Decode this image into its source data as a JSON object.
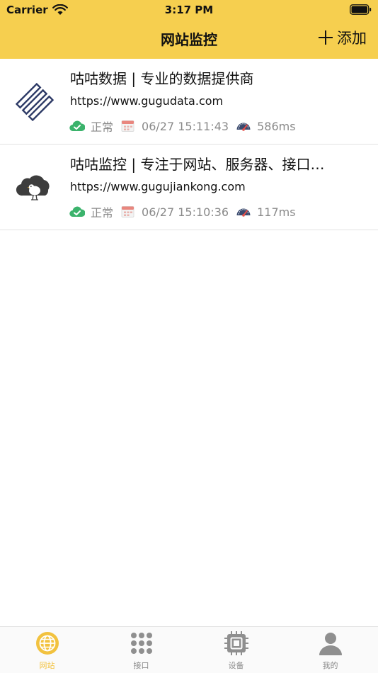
{
  "status_bar": {
    "carrier": "Carrier",
    "time": "3:17 PM"
  },
  "nav": {
    "title": "网站监控",
    "add_label": "添加"
  },
  "sites": [
    {
      "icon": "gugudata-logo-icon",
      "title": "咕咕数据 | 专业的数据提供商",
      "url": "https://www.gugudata.com",
      "status": "正常",
      "time": "06/27 15:11:43",
      "latency": "586ms"
    },
    {
      "icon": "gugujiankong-logo-icon",
      "title": "咕咕监控 | 专注于网站、服务器、接口…",
      "url": "https://www.gugujiankong.com",
      "status": "正常",
      "time": "06/27 15:10:36",
      "latency": "117ms"
    }
  ],
  "tabs": [
    {
      "label": "网站",
      "icon": "globe-icon",
      "active": true
    },
    {
      "label": "接口",
      "icon": "grid-dots-icon",
      "active": false
    },
    {
      "label": "设备",
      "icon": "chip-icon",
      "active": false
    },
    {
      "label": "我的",
      "icon": "user-icon",
      "active": false
    }
  ],
  "colors": {
    "accent": "#f6cf4f",
    "status_ok": "#3bb36c",
    "meta_text": "#8a8a8a",
    "tab_active": "#f2c23f",
    "tab_inactive": "#8a8a8a"
  }
}
